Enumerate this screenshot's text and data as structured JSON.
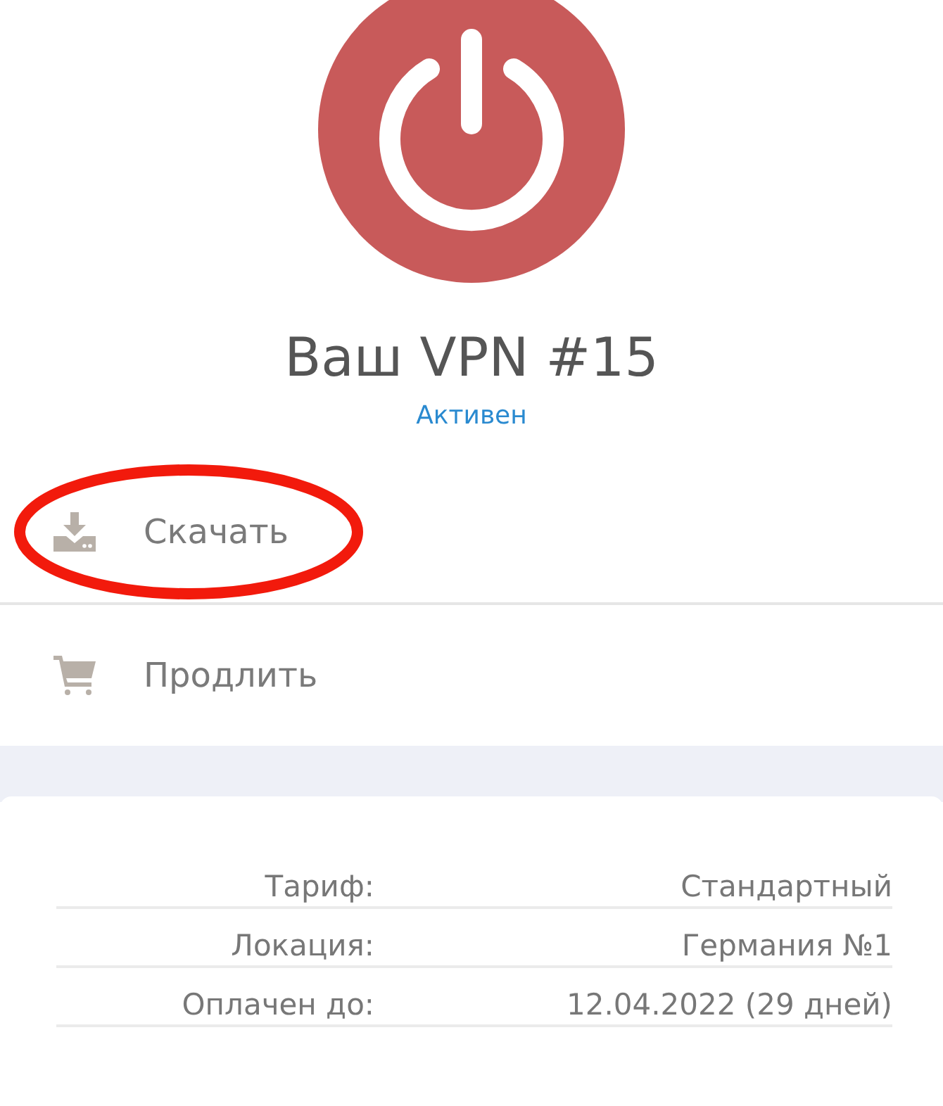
{
  "vpn": {
    "title": "Ваш VPN #15",
    "status": "Активен"
  },
  "actions": [
    {
      "kind": "download",
      "label": "Скачать",
      "highlighted": true
    },
    {
      "kind": "cart",
      "label": "Продлить",
      "highlighted": false
    }
  ],
  "details": [
    {
      "label": "Тариф:",
      "value": "Стандартный"
    },
    {
      "label": "Локация:",
      "value": "Германия №1"
    },
    {
      "label": "Оплачен до:",
      "value": "12.04.2022 (29 дней)"
    }
  ]
}
